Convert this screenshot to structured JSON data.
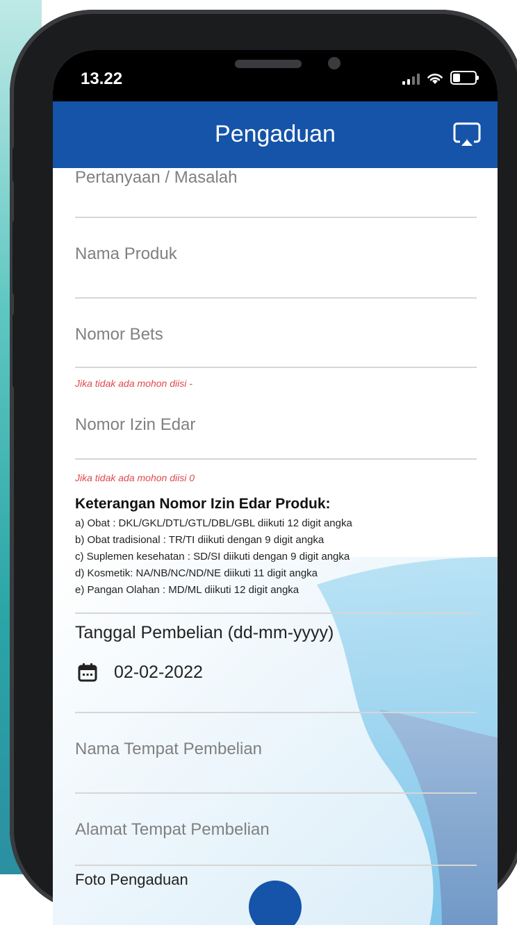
{
  "status": {
    "time": "13.22"
  },
  "appbar": {
    "title": "Pengaduan",
    "cast_icon": "screen-cast-icon"
  },
  "form": {
    "question_label": "Pertanyaan / Masalah",
    "product_label": "Nama Produk",
    "batch_label": "Nomor Bets",
    "batch_hint": "Jika tidak ada mohon diisi -",
    "permit_label": "Nomor Izin Edar",
    "permit_hint": "Jika tidak ada mohon diisi 0",
    "info_title": "Keterangan Nomor Izin Edar Produk:",
    "info_items": [
      "a) Obat : DKL/GKL/DTL/GTL/DBL/GBL diikuti 12 digit angka",
      "b) Obat tradisional : TR/TI diikuti dengan 9 digit angka",
      "c) Suplemen kesehatan : SD/SI diikuti dengan 9 digit angka",
      "d) Kosmetik: NA/NB/NC/ND/NE diikuti 11 digit angka",
      "e) Pangan Olahan : MD/ML diikuti 12 digit angka"
    ],
    "date_label": "Tanggal Pembelian (dd-mm-yyyy)",
    "date_value": "02-02-2022",
    "place_label": "Nama Tempat Pembelian",
    "address_label": "Alamat Tempat Pembelian",
    "photo_label": "Foto Pengaduan"
  },
  "colors": {
    "primary": "#1554a8",
    "hint": "#e0474c",
    "divider": "#d6d6d6"
  }
}
